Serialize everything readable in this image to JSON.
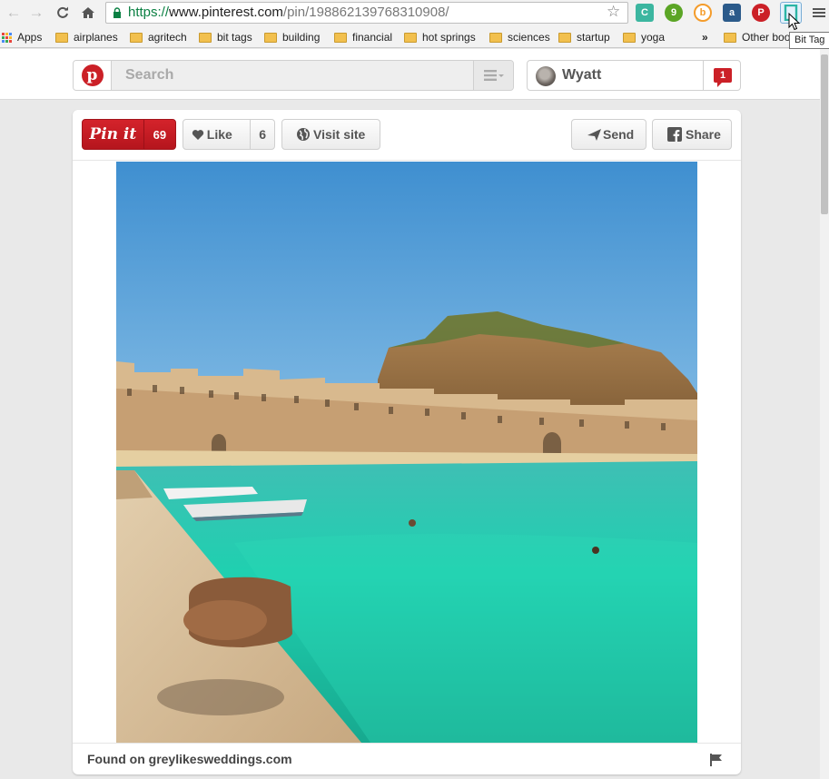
{
  "browser": {
    "url": {
      "scheme": "https://",
      "host": "www.pinterest.com",
      "path": "/pin/198862139768310908/"
    },
    "bookmarks": [
      {
        "label": "Apps"
      },
      {
        "label": "airplanes"
      },
      {
        "label": "agritech"
      },
      {
        "label": "bit tags"
      },
      {
        "label": "building"
      },
      {
        "label": "financial"
      },
      {
        "label": "hot springs"
      },
      {
        "label": "sciences"
      },
      {
        "label": "startup"
      },
      {
        "label": "yoga"
      }
    ],
    "overflow_label": "»",
    "other_bookmarks": "Other boo",
    "tooltip": "Bit Tag",
    "extensions": [
      {
        "icon": "c-extension-icon",
        "label": "C",
        "color": "#3cb6a0"
      },
      {
        "icon": "evernote-icon",
        "label": "9",
        "color": "#5ba525"
      },
      {
        "icon": "b-extension-icon",
        "label": "b",
        "color": "#f49c2b"
      },
      {
        "icon": "amazon-icon",
        "label": "a",
        "color": "#2b5a8a"
      },
      {
        "icon": "pinterest-icon",
        "label": "P",
        "color": "#cb2027"
      }
    ]
  },
  "header": {
    "search_placeholder": "Search",
    "user_name": "Wyatt",
    "notification_count": "1"
  },
  "pin": {
    "pinit_label": "Pin it",
    "pin_count": "69",
    "like_label": "Like",
    "like_count": "6",
    "visit_label": "Visit site",
    "send_label": "Send",
    "share_label": "Share",
    "found_on": "Found on greylikesweddings.com"
  },
  "colors": {
    "brand_red": "#cb2027",
    "water": "#21c4aa",
    "sky": "#5fa8de"
  }
}
